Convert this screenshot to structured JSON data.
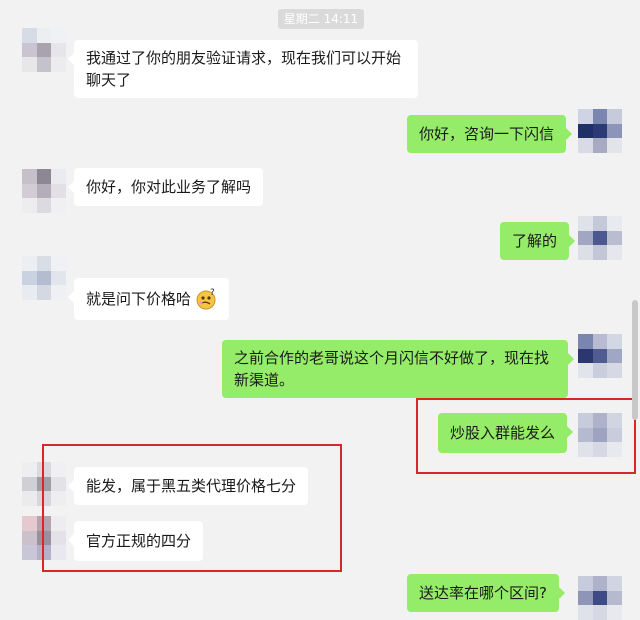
{
  "chat": {
    "timestamp": "星期二 14:11",
    "messages": [
      {
        "side": "in",
        "text": "我通过了你的朋友验证请求，现在我们可以开始聊天了"
      },
      {
        "side": "out",
        "text": "你好，咨询一下闪信"
      },
      {
        "side": "in",
        "text": "你好，你对此业务了解吗"
      },
      {
        "side": "out",
        "text": "了解的"
      },
      {
        "side": "in",
        "text": "就是问下价格哈",
        "emoji": "thinking-face-emoji"
      },
      {
        "side": "out",
        "text": "之前合作的老哥说这个月闪信不好做了，现在找新渠道。"
      },
      {
        "side": "out",
        "text": "炒股入群能发么"
      },
      {
        "side": "in",
        "text": "能发，属于黑五类代理价格七分"
      },
      {
        "side": "in",
        "text": "官方正规的四分"
      },
      {
        "side": "out",
        "text": "送达率在哪个区间?"
      }
    ]
  },
  "colors": {
    "background": "#f2f2f2",
    "incoming_bubble": "#ffffff",
    "outgoing_bubble": "#95ec69",
    "highlight_box": "#d9262b"
  }
}
